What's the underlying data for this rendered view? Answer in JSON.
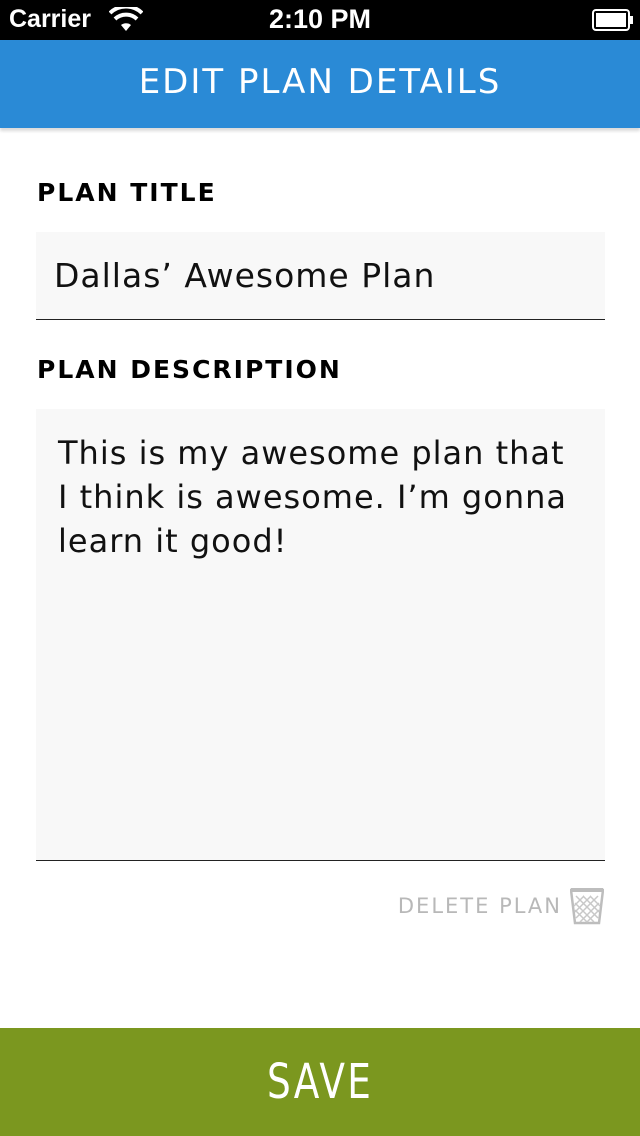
{
  "status_bar": {
    "carrier": "Carrier",
    "time": "2:10 PM",
    "icons": [
      "wifi-icon",
      "battery-icon"
    ]
  },
  "header": {
    "title": "EDIT PLAN DETAILS",
    "color": "#2a8ad6"
  },
  "form": {
    "title_label": "PLAN TITLE",
    "title_value": "Dallas’ Awesome Plan",
    "description_label": "PLAN DESCRIPTION",
    "description_value": "This is my awesome plan that I think is awesome. I’m gonna learn it good!"
  },
  "actions": {
    "delete_label": "DELETE PLAN",
    "delete_icon": "trash-icon",
    "save_label": "SAVE",
    "save_color": "#7b971f"
  }
}
